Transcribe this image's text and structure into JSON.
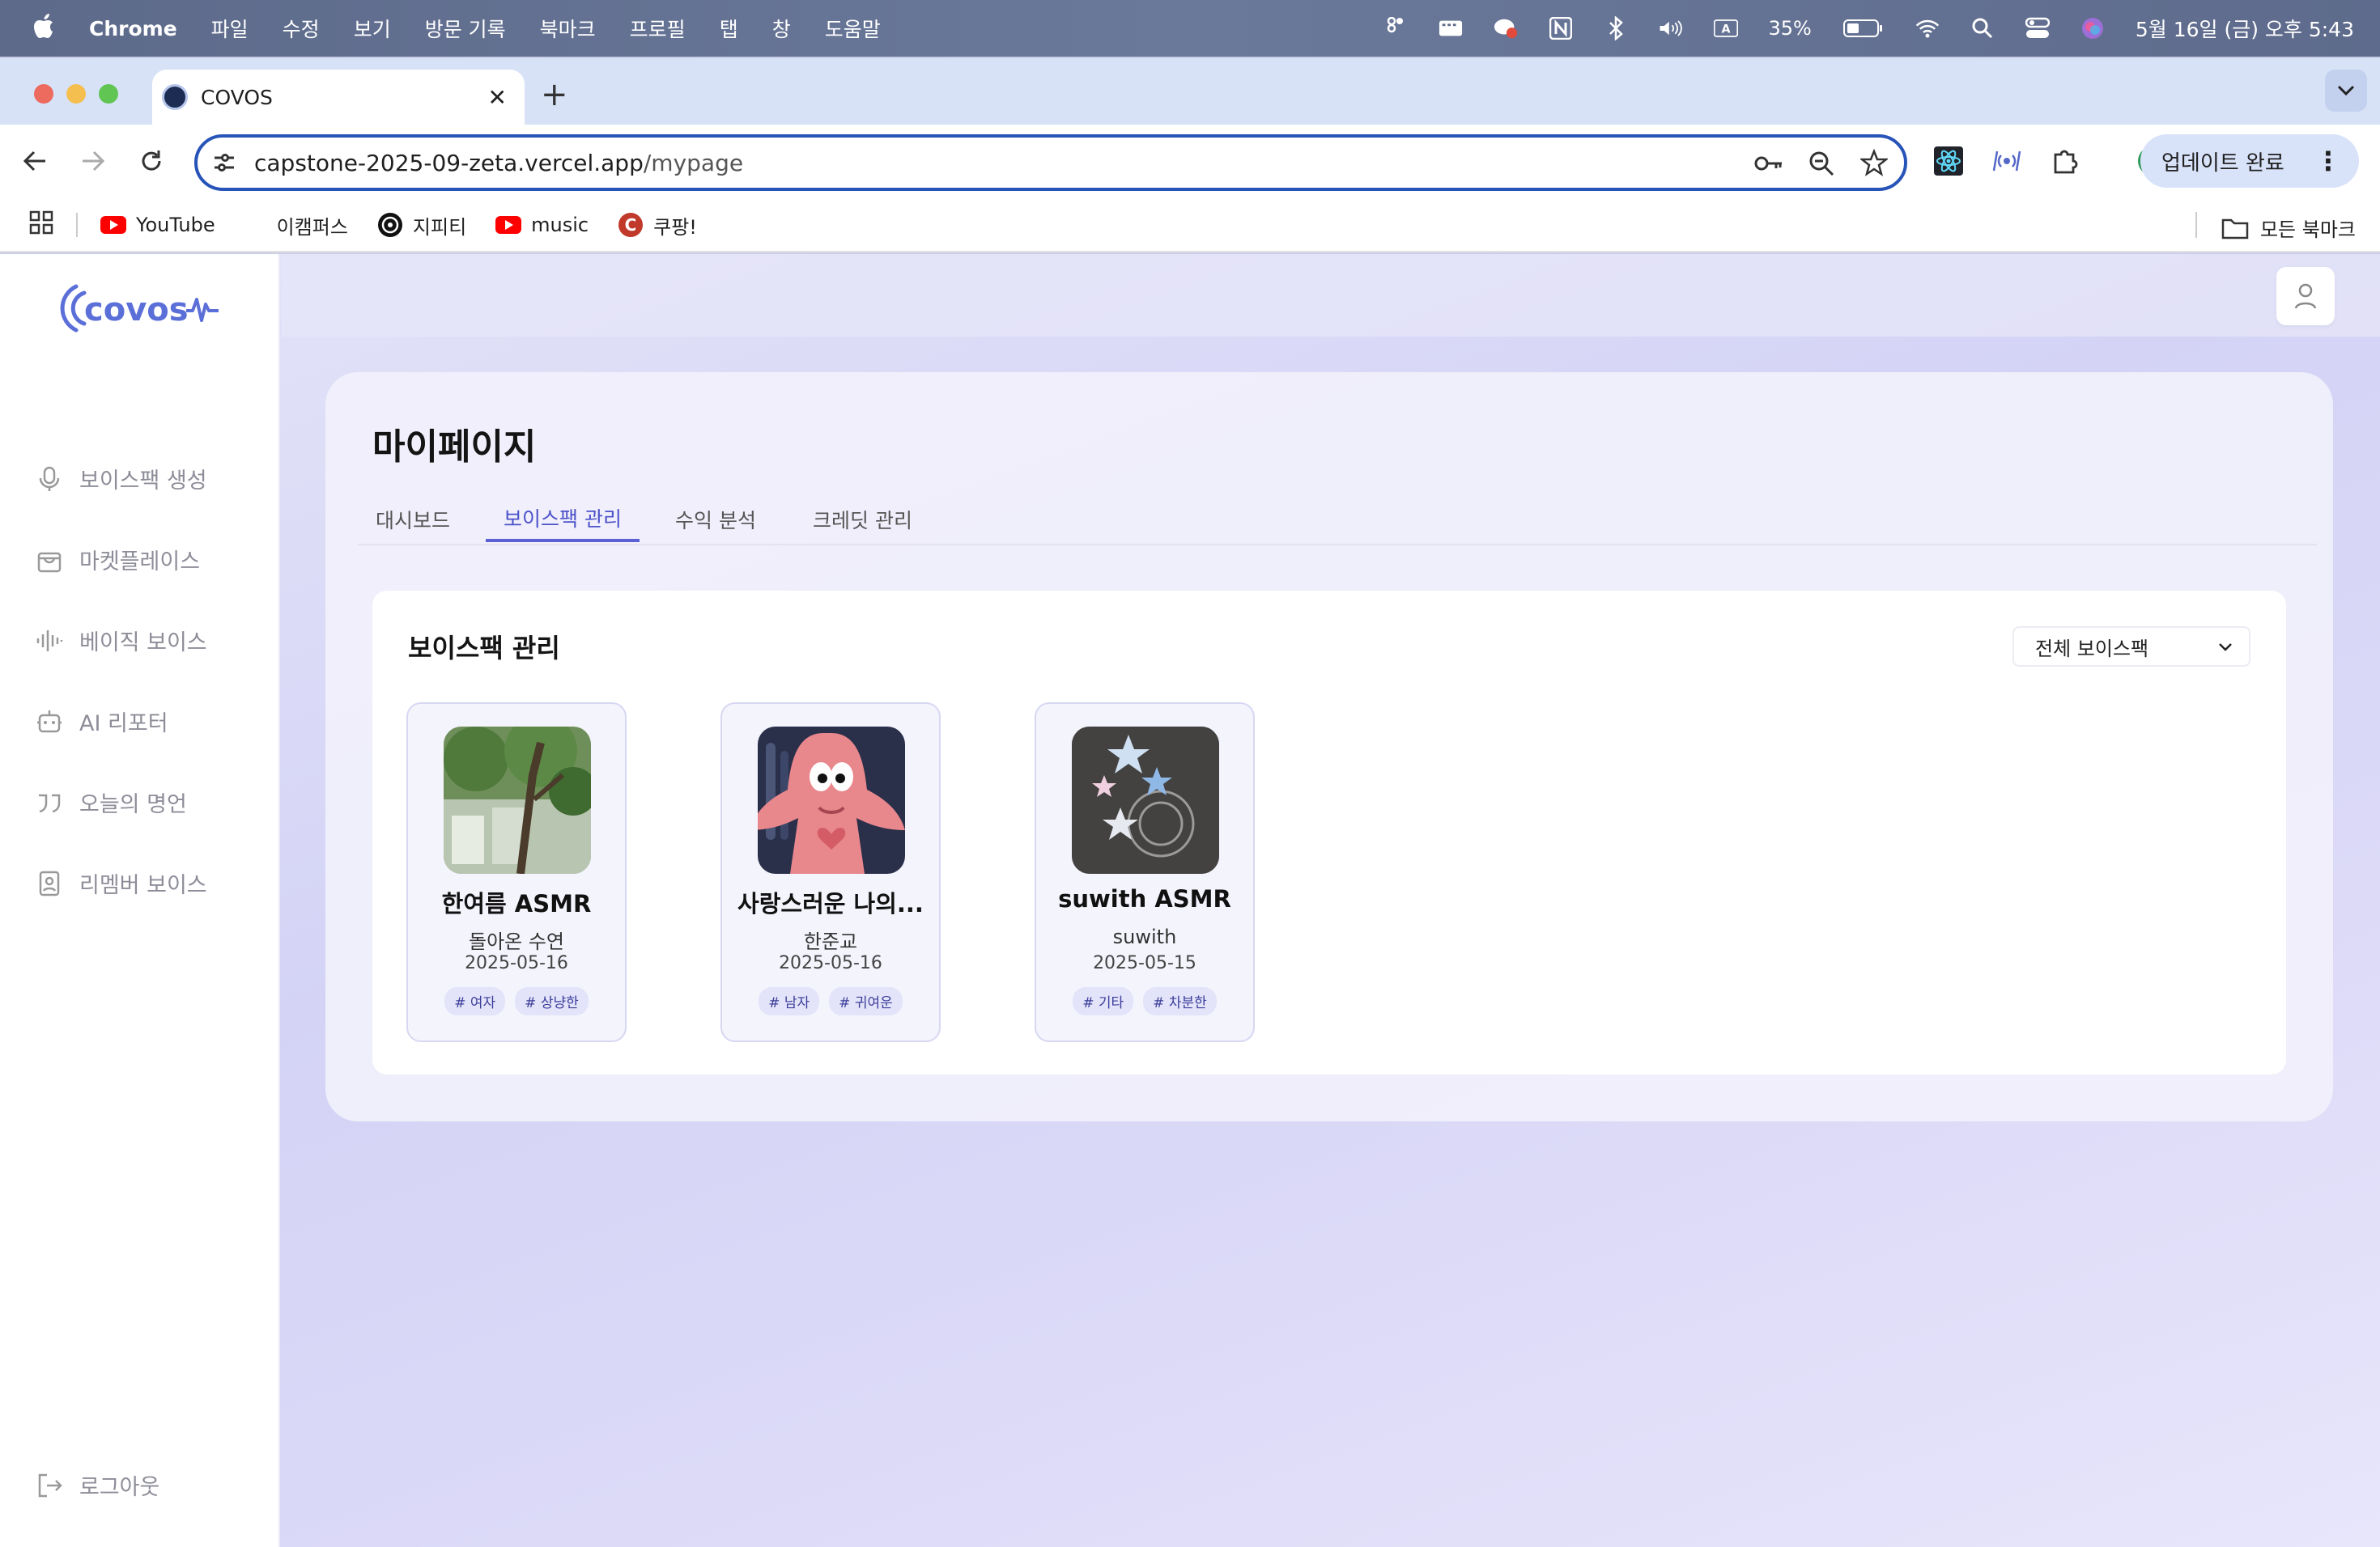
{
  "menubar": {
    "app": "Chrome",
    "items": [
      "파일",
      "수정",
      "보기",
      "방문 기록",
      "북마크",
      "프로필",
      "탭",
      "창",
      "도움말"
    ],
    "battery": "35%",
    "datetime": "5월 16일 (금) 오후 5:43"
  },
  "browser": {
    "tab_title": "COVOS",
    "url_host": "capstone-2025-09-zeta.vercel.app",
    "url_path": "/mypage",
    "update_label": "업데이트 완료",
    "bookmarks": [
      {
        "label": "YouTube",
        "icon": "youtube-icon"
      },
      {
        "label": "이캠퍼스",
        "icon": ""
      },
      {
        "label": "지피티",
        "icon": "chatgpt-icon"
      },
      {
        "label": "music",
        "icon": "youtube-icon"
      },
      {
        "label": "쿠팡!",
        "icon": "coupang-icon"
      }
    ],
    "all_bookmarks": "모든 북마크"
  },
  "sidebar": {
    "logo": "covos",
    "items": [
      {
        "label": "보이스팩 생성",
        "icon": "mic-icon"
      },
      {
        "label": "마켓플레이스",
        "icon": "bag-icon"
      },
      {
        "label": "베이직 보이스",
        "icon": "waveform-icon"
      },
      {
        "label": "AI 리포터",
        "icon": "bot-icon"
      },
      {
        "label": "오늘의 명언",
        "icon": "quote-icon"
      },
      {
        "label": "리멤버 보이스",
        "icon": "portrait-icon"
      }
    ],
    "logout": "로그아웃"
  },
  "main": {
    "page_title": "마이페이지",
    "tabs": [
      {
        "label": "대시보드",
        "active": false
      },
      {
        "label": "보이스팩 관리",
        "active": true
      },
      {
        "label": "수익 분석",
        "active": false
      },
      {
        "label": "크레딧 관리",
        "active": false
      }
    ],
    "section_title": "보이스팩 관리",
    "filter_value": "전체 보이스팩",
    "voicepacks": [
      {
        "name": "한여름 ASMR",
        "owner": "돌아온 수연",
        "date": "2025-05-16",
        "tags": [
          "# 여자",
          "# 상냥한"
        ]
      },
      {
        "name": "사랑스러운 나의...",
        "owner": "한준교",
        "date": "2025-05-16",
        "tags": [
          "# 남자",
          "# 귀여운"
        ]
      },
      {
        "name": "suwith ASMR",
        "owner": "suwith",
        "date": "2025-05-15",
        "tags": [
          "# 기타",
          "# 차분한"
        ]
      }
    ]
  },
  "colors": {
    "accent": "#5b60d6",
    "omnibox_border": "#2754b8",
    "tag_bg": "#e3e3fa"
  }
}
